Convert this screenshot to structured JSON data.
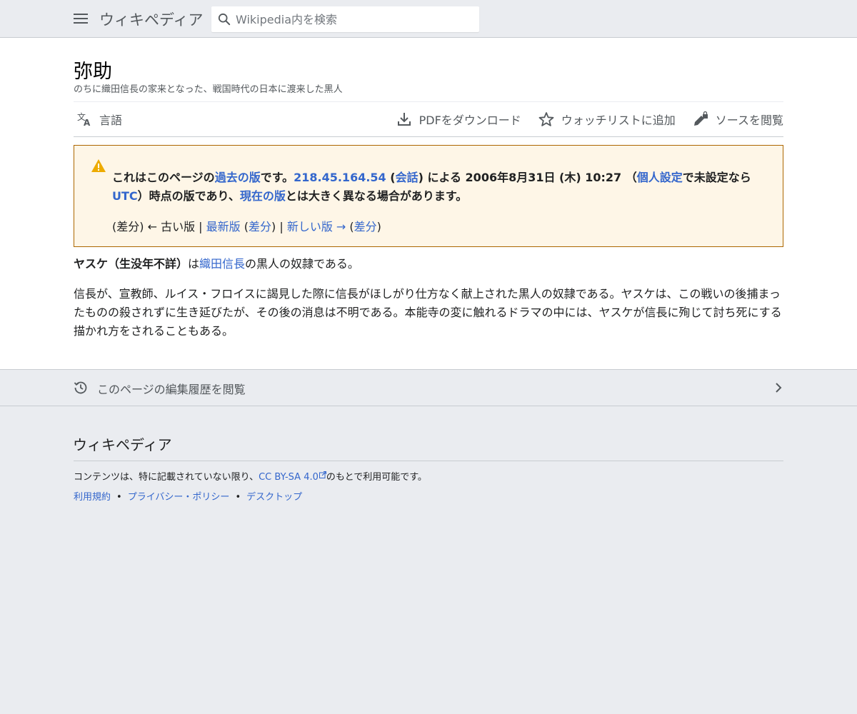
{
  "header": {
    "logo": "ウィキペディア",
    "search_placeholder": "Wikipedia内を検索"
  },
  "article": {
    "title": "弥助",
    "tagline": "のちに織田信長の家来となった、戦国時代の日本に渡来した黒人"
  },
  "toolbar": {
    "language": "言語",
    "pdf": "PDFをダウンロード",
    "watchlist": "ウォッチリストに追加",
    "source": "ソースを閲覧"
  },
  "notice": {
    "t1": "これはこのページの",
    "past_version": "過去の版",
    "t2": "です。",
    "ip": "218.45.164.54",
    "t3": " (",
    "talk": "会話",
    "t4": ") による 2006年8月31日 (木) 10:27 （",
    "prefs": "個人設定",
    "t5": "で未設定なら",
    "utc": "UTC",
    "t6": "）時点の版であり、",
    "current_version": "現在の版",
    "t7": "とは大きく異なる場合があります。",
    "nav_diff1": "(差分) ← 古い版 | ",
    "nav_latest": "最新版",
    "nav_sp1": " (",
    "nav_diff2": "差分",
    "nav_mid": ") | ",
    "nav_newer": "新しい版 →",
    "nav_sp2": " (",
    "nav_diff3": "差分",
    "nav_end": ")"
  },
  "body": {
    "p1_bold": "ヤスケ（生没年不詳）",
    "p1_t1": "は",
    "p1_link": "織田信長",
    "p1_t2": "の黒人の奴隷である。",
    "p2": "信長が、宣教師、ルイス・フロイスに謁見した際に信長がほしがり仕方なく献上された黒人の奴隷である。ヤスケは、この戦いの後捕まったものの殺されずに生き延びたが、その後の消息は不明である。本能寺の変に触れるドラマの中には、ヤスケが信長に殉じて討ち死にする描かれ方をされることもある。"
  },
  "history": {
    "label": "このページの編集履歴を閲覧"
  },
  "footer": {
    "logo": "ウィキペディア",
    "license_t1": "コンテンツは、特に記載されていない限り、",
    "license_link": "CC BY-SA 4.0",
    "license_t2": "のもとで利用可能です。",
    "links": [
      "利用規約",
      "プライバシー・ポリシー",
      "デスクトップ"
    ],
    "separator": "•"
  },
  "colors": {
    "link": "#3366cc",
    "notice_bg": "#fef6e7",
    "notice_border": "#ac6600",
    "warning": "#edab00"
  }
}
